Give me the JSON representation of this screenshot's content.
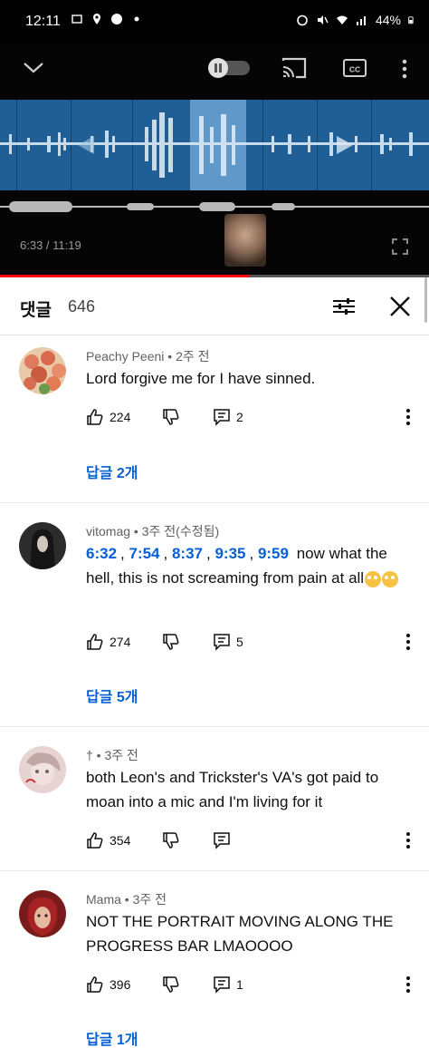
{
  "status_bar": {
    "time": "12:11",
    "battery": "44%"
  },
  "player": {
    "time_label": "6:33 / 11:19",
    "progress_fraction": 0.58,
    "accent_color": "#ff0000"
  },
  "comments_header": {
    "title": "댓글",
    "count": "646"
  },
  "comments": [
    {
      "author": "Peachy Peeni",
      "time": "2주 전",
      "text": "Lord forgive me for I have sinned.",
      "likes": "224",
      "reply_count": "2",
      "replies_link": "답글 2개"
    },
    {
      "author": "vitomag",
      "time": "3주 전(수정됨)",
      "timestamps": [
        "6:32",
        "7:54",
        "8:37",
        "9:35",
        "9:59"
      ],
      "text_after_timestamps": "now what the hell, this is not screaming from pain at all",
      "likes": "274",
      "reply_count": "5",
      "replies_link": "답글 5개"
    },
    {
      "author": "†",
      "time": "3주 전",
      "text": "both Leon's and Trickster's VA's got paid to moan into a mic and I'm living for it",
      "likes": "354",
      "reply_count": ""
    },
    {
      "author": "Mama",
      "time": "3주 전",
      "text": "NOT THE PORTRAIT MOVING ALONG THE PROGRESS BAR LMAOOOO",
      "likes": "396",
      "reply_count": "1",
      "replies_link": "답글 1개"
    }
  ]
}
